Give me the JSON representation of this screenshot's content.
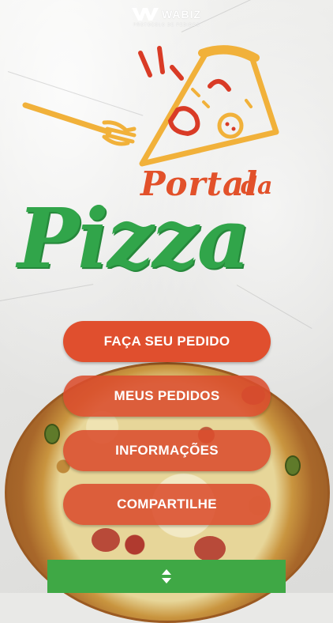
{
  "header": {
    "brand_name": "WABIZ",
    "brand_tagline": "PROTOCOLO DE PEDIDOS"
  },
  "logo": {
    "title_line1": "Portal",
    "title_connector": "da",
    "title_line2": "Pizza"
  },
  "menu": {
    "buttons": [
      {
        "label": "FAÇA SEU PEDIDO"
      },
      {
        "label": "MEUS PEDIDOS"
      },
      {
        "label": "INFORMAÇÕES"
      },
      {
        "label": "COMPARTILHE"
      }
    ]
  },
  "bottom_bar": {
    "icon": "expand-arrows-icon"
  },
  "colors": {
    "primary_red": "#db4d2d",
    "brand_green": "#31a54a",
    "accent_yellow": "#f1b13a"
  }
}
